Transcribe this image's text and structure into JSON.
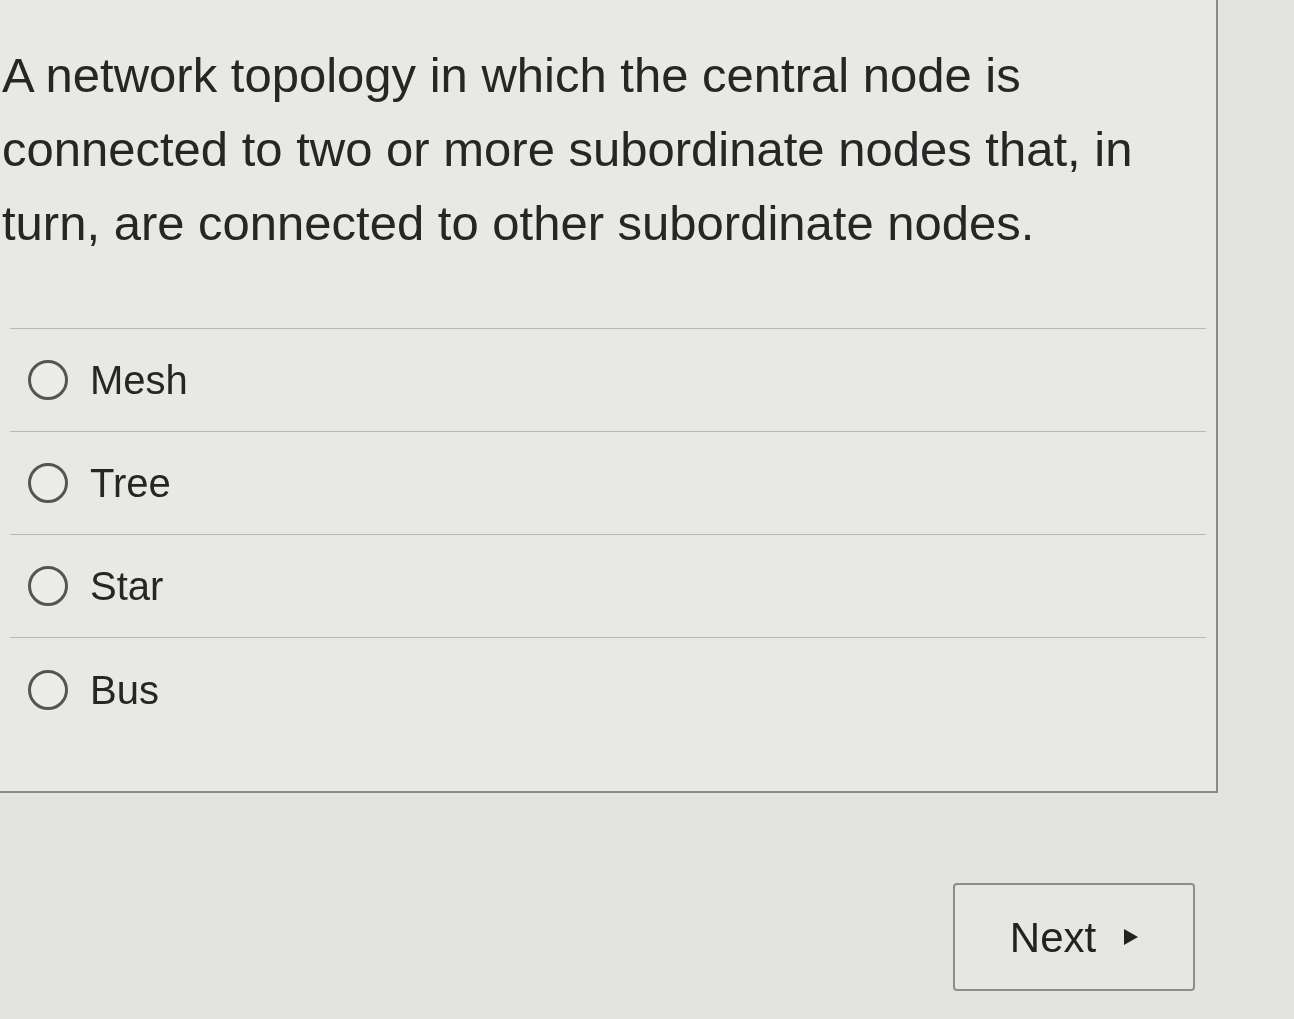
{
  "question": "A network topology in which the central node is connected to two or more subordinate nodes that, in turn, are connected to other subordinate nodes.",
  "options": [
    {
      "label": "Mesh",
      "selected": false
    },
    {
      "label": "Tree",
      "selected": false
    },
    {
      "label": "Star",
      "selected": false
    },
    {
      "label": "Bus",
      "selected": false
    }
  ],
  "next_button": {
    "label": "Next"
  }
}
